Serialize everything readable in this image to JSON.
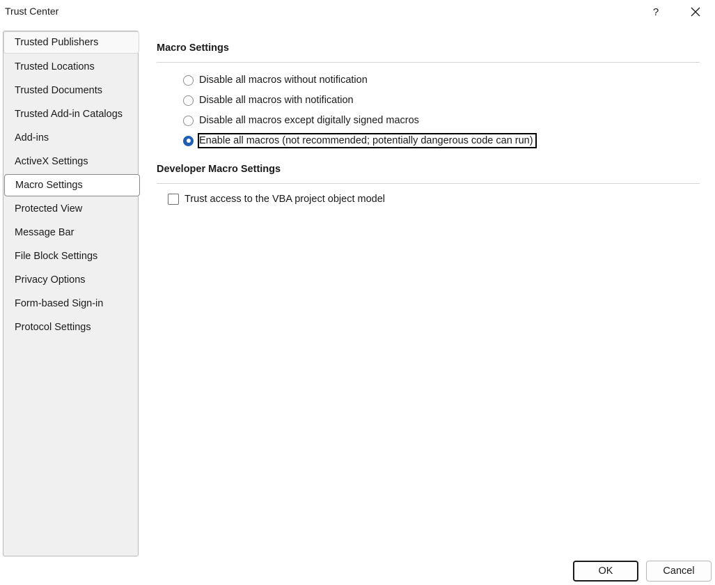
{
  "window": {
    "title": "Trust Center",
    "help_label": "?"
  },
  "sidebar": {
    "items": [
      {
        "label": "Trusted Publishers"
      },
      {
        "label": "Trusted Locations"
      },
      {
        "label": "Trusted Documents"
      },
      {
        "label": "Trusted Add-in Catalogs"
      },
      {
        "label": "Add-ins"
      },
      {
        "label": "ActiveX Settings"
      },
      {
        "label": "Macro Settings"
      },
      {
        "label": "Protected View"
      },
      {
        "label": "Message Bar"
      },
      {
        "label": "File Block Settings"
      },
      {
        "label": "Privacy Options"
      },
      {
        "label": "Form-based Sign-in"
      },
      {
        "label": "Protocol Settings"
      }
    ],
    "selected": "Macro Settings"
  },
  "macro_settings": {
    "title": "Macro Settings",
    "options": [
      {
        "label": "Disable all macros without notification",
        "checked": false
      },
      {
        "label": "Disable all macros with notification",
        "checked": false
      },
      {
        "label": "Disable all macros except digitally signed macros",
        "checked": false
      },
      {
        "label": "Enable all macros (not recommended; potentially dangerous code can run)",
        "checked": true
      }
    ]
  },
  "developer_settings": {
    "title": "Developer Macro Settings",
    "trust_vba_label": "Trust access to the VBA project object model",
    "trust_vba_checked": false
  },
  "buttons": {
    "ok": "OK",
    "cancel": "Cancel"
  },
  "colors": {
    "accent": "#1f5fb3",
    "sidebar_bg": "#f0f0f0"
  }
}
